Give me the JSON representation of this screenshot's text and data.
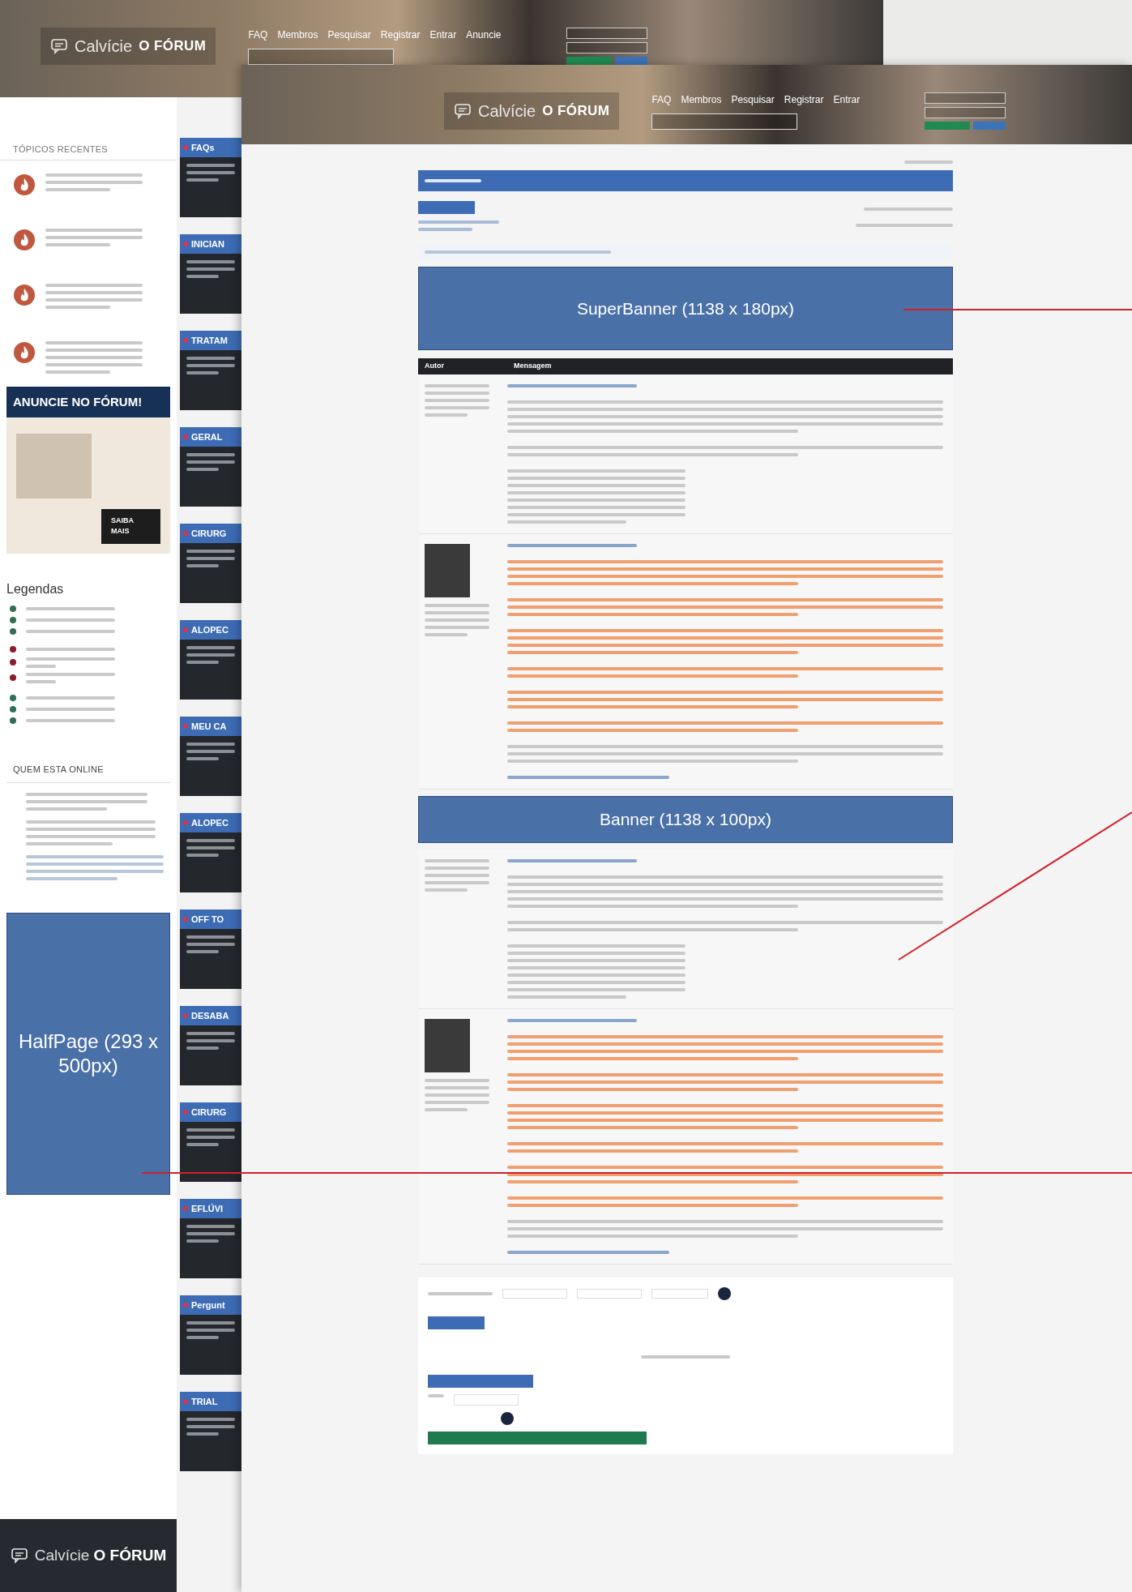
{
  "back_page": {
    "header": {
      "logo_word": "Calvície",
      "logo_tag": "O FÓRUM",
      "nav": [
        "FAQ",
        "Membros",
        "Pesquisar",
        "Registrar",
        "Entrar",
        "Anuncie"
      ]
    },
    "recent_topics": {
      "title": "TÓPICOS RECENTES"
    },
    "ad": {
      "title": "ANUNCIE NO FÓRUM!",
      "button": "SAIBA MAIS"
    },
    "legend": {
      "title": "Legendas",
      "items": [
        {
          "color": "#2f6f55"
        },
        {
          "color": "#2f6f55"
        },
        {
          "color": "#2f6f55"
        },
        {
          "color": "#8e1b2e"
        },
        {
          "color": "#8e1b2e"
        },
        {
          "color": "#8e1b2e"
        },
        {
          "color": "#2f6f55"
        },
        {
          "color": "#2f6f55"
        },
        {
          "color": "#2f6f55"
        }
      ]
    },
    "online": {
      "title": "QUEM ESTA ONLINE"
    },
    "half_page_banner": "HalfPage (293 x 500px)",
    "categories": [
      "FAQs",
      "INICIAN",
      "TRATAM",
      "GERAL",
      "CIRURG",
      "ALOPEC",
      "MEU CA",
      "ALOPEC",
      "OFF TO",
      "DESABA",
      "CIRURG",
      "EFLÚVI",
      "Pergunt",
      "TRIAL"
    ],
    "footer": {
      "logo_word": "Calvície",
      "logo_tag": "O FÓRUM"
    }
  },
  "front_page": {
    "header": {
      "logo_word": "Calvície",
      "logo_tag": "O FÓRUM",
      "nav": [
        "FAQ",
        "Membros",
        "Pesquisar",
        "Registrar",
        "Entrar"
      ]
    },
    "super_banner": "SuperBanner (1138 x 180px)",
    "table_columns": [
      "Autor",
      "Mensagem"
    ],
    "banner": "Banner (1138 x 100px)"
  }
}
